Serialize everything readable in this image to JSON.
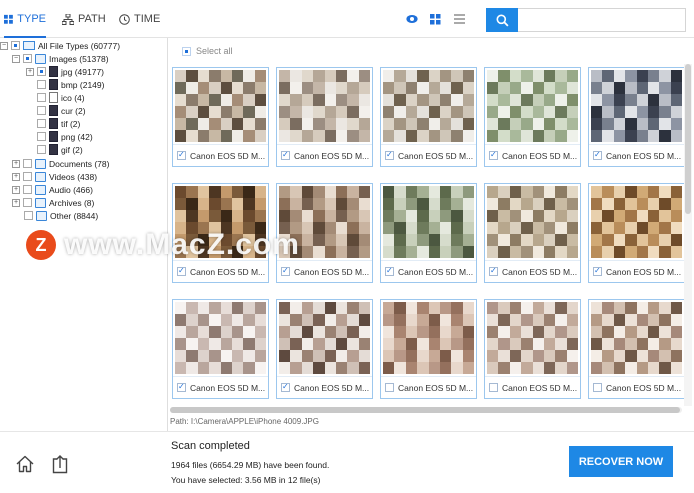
{
  "tabs": [
    {
      "label": "TYPE",
      "icon": "grid-icon",
      "active": true
    },
    {
      "label": "PATH",
      "icon": "sitemap-icon",
      "active": false
    },
    {
      "label": "TIME",
      "icon": "clock-icon",
      "active": false
    }
  ],
  "view_modes": [
    "eye-icon",
    "grid-view-icon",
    "list-view-icon"
  ],
  "search": {
    "placeholder": "",
    "value": ""
  },
  "tree": {
    "root": {
      "label": "All File Types (60777)"
    },
    "images": {
      "label": "Images (51378)"
    },
    "jpg": {
      "label": "jpg (49177)"
    },
    "bmp": {
      "label": "bmp (2149)"
    },
    "ico": {
      "label": "ico (4)"
    },
    "cur": {
      "label": "cur (2)"
    },
    "tif": {
      "label": "tif (2)"
    },
    "png": {
      "label": "png (42)"
    },
    "gif": {
      "label": "gif (2)"
    },
    "documents": {
      "label": "Documents (78)"
    },
    "videos": {
      "label": "Videos (438)"
    },
    "audio": {
      "label": "Audio (466)"
    },
    "archives": {
      "label": "Archives (8)"
    },
    "other": {
      "label": "Other (8844)"
    }
  },
  "grid": {
    "select_all_label": "Select all",
    "cards": [
      {
        "name": "Canon EOS 5D M...",
        "checked": true,
        "palette": [
          "#d9cfc3",
          "#a58d77",
          "#efece6",
          "#6f6a5a",
          "#c7b8a4",
          "#8b7c6c",
          "#e6ddd0",
          "#5d4e3f"
        ]
      },
      {
        "name": "Canon EOS 5D M...",
        "checked": true,
        "palette": [
          "#ebe7e2",
          "#c4b6a8",
          "#9c8e82",
          "#f3f0ec",
          "#7b6d60",
          "#d6cbbd",
          "#b5a797",
          "#e0d8cc"
        ]
      },
      {
        "name": "Canon EOS 5D M...",
        "checked": true,
        "palette": [
          "#e4e1db",
          "#b5a998",
          "#f0eeea",
          "#8e8170",
          "#cfc6b8",
          "#a39582",
          "#dbd3c6",
          "#6f624f"
        ]
      },
      {
        "name": "Canon EOS 5D M...",
        "checked": true,
        "palette": [
          "#a9b99b",
          "#d3ddc9",
          "#7f8f6b",
          "#eef1ea",
          "#98a989",
          "#c5cfb9",
          "#6c7a5c",
          "#dfe5d8"
        ]
      },
      {
        "name": "Canon EOS 5D M...",
        "checked": true,
        "palette": [
          "#3b4150",
          "#8d94a3",
          "#e2e4e8",
          "#5e6675",
          "#b9bdc6",
          "#2c313d",
          "#cfd2d8",
          "#79808e"
        ]
      },
      {
        "name": "Canon EOS 5D M...",
        "checked": true,
        "palette": [
          "#7a5a3a",
          "#c49a6c",
          "#4d3622",
          "#e0c49f",
          "#9a7550",
          "#6b4a2e",
          "#d7b48a",
          "#3a2817"
        ]
      },
      {
        "name": "Canon EOS 5D M...",
        "checked": true,
        "palette": [
          "#c9b3a0",
          "#8c6f58",
          "#e9ddd1",
          "#a48b76",
          "#5f4a39",
          "#d8c6b5",
          "#b29a84",
          "#766050"
        ]
      },
      {
        "name": "Canon EOS 5D M...",
        "checked": true,
        "palette": [
          "#8e9a7d",
          "#c8d0bb",
          "#5d6a4c",
          "#e5e9de",
          "#a5b094",
          "#6e7b5c",
          "#d6dccc",
          "#4c5840"
        ]
      },
      {
        "name": "Canon EOS 5D M...",
        "checked": true,
        "palette": [
          "#b7a78d",
          "#e3d8c5",
          "#8d7c63",
          "#f0e9dd",
          "#a1917a",
          "#c9bba3",
          "#6f604b",
          "#dad0bf"
        ]
      },
      {
        "name": "Canon EOS 5D M...",
        "checked": true,
        "palette": [
          "#b98d5a",
          "#e2c49a",
          "#8a6238",
          "#f0dcbf",
          "#a27648",
          "#d1aa76",
          "#6e4b29",
          "#e8d0ad"
        ]
      },
      {
        "name": "Canon EOS 5D M...",
        "checked": true,
        "palette": [
          "#efe9e6",
          "#c9b8b1",
          "#f7f3f1",
          "#a8948b",
          "#ddd2cc",
          "#8e7a71",
          "#e7ddd8",
          "#b9a69d"
        ]
      },
      {
        "name": "Canon EOS 5D M...",
        "checked": true,
        "palette": [
          "#e4dcd6",
          "#b79f92",
          "#f2ede9",
          "#7a6255",
          "#cfc0b6",
          "#9a8273",
          "#ebe4de",
          "#5e4a3f"
        ]
      },
      {
        "name": "Canon EOS 5D M...",
        "checked": false,
        "palette": [
          "#dcc6b6",
          "#a98470",
          "#f0e5dc",
          "#7d5c4a",
          "#c7a996",
          "#e8d8cc",
          "#94705d",
          "#b89887"
        ]
      },
      {
        "name": "Canon EOS 5D M...",
        "checked": false,
        "palette": [
          "#eae0d8",
          "#c2aa9a",
          "#f5f0ec",
          "#9b8170",
          "#dacabd",
          "#b0968a",
          "#e3d6cb",
          "#7e6758"
        ]
      },
      {
        "name": "Canon EOS 5D M...",
        "checked": false,
        "palette": [
          "#e7d9cd",
          "#b59a85",
          "#f4ede6",
          "#8e735f",
          "#d3c0b0",
          "#a6897a",
          "#ede2d8",
          "#6f5847"
        ]
      }
    ]
  },
  "path": {
    "text": "Path:   I:\\Camera\\APPLE\\iPhone 4009.JPG"
  },
  "status": {
    "title": "Scan completed",
    "found": "1964 files (6654.29 MB) have been found.",
    "selected": "You have selected: 3.56 MB in 12 file(s)"
  },
  "actions": {
    "recover_label": "RECOVER NOW"
  },
  "watermark": {
    "logo": "Z",
    "text": "www.MacZ.com"
  },
  "colors": {
    "accent": "#1e88e5",
    "active_tab": "#1e6fd9",
    "card_border": "#9cc7ee"
  }
}
